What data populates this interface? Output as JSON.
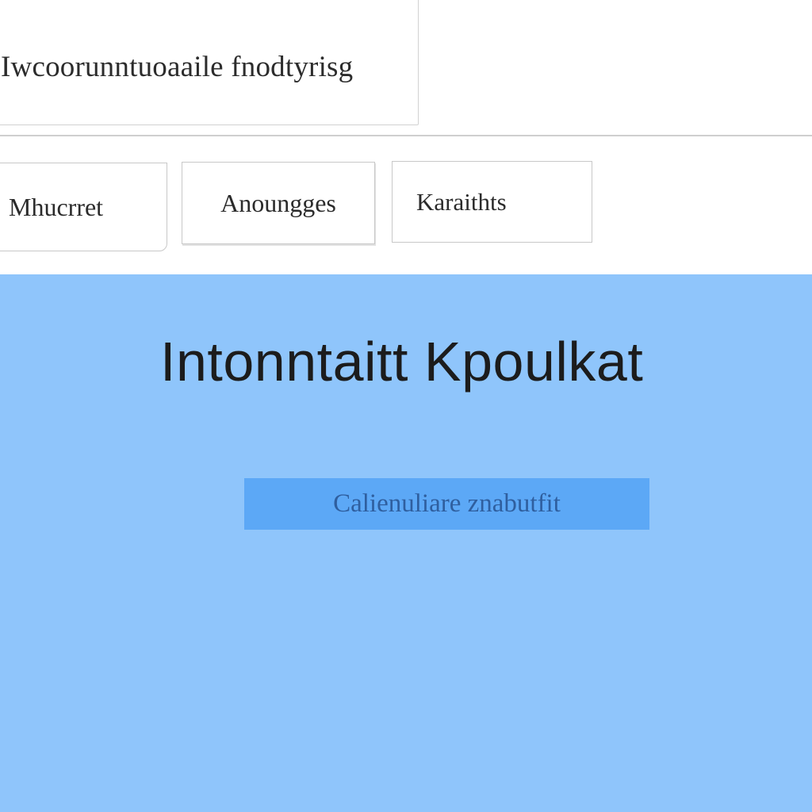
{
  "search": {
    "text": "Iwcoorunntuoaaile fnodtyrisg"
  },
  "tabs": [
    {
      "label": "Mhucrret"
    },
    {
      "label": "Anoungges"
    },
    {
      "label": "Karaithts"
    }
  ],
  "content": {
    "title": "Intonntaitt Kpoulkat",
    "button_label": "Calienuliare znabutfit"
  },
  "colors": {
    "panel_background": "#8fc5fb",
    "button_background": "#5ca8f6",
    "button_text": "#2f5f9f"
  }
}
